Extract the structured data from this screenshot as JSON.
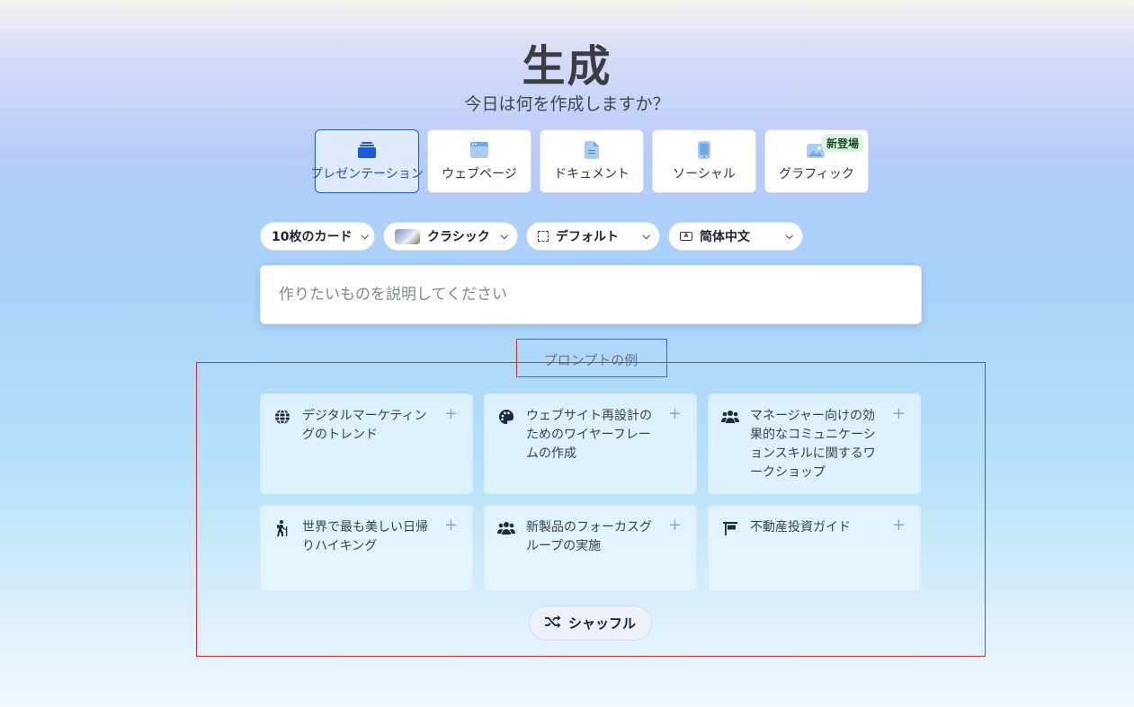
{
  "header": {
    "title": "生成",
    "subtitle": "今日は何を作成しますか？"
  },
  "content_types": [
    {
      "label": "プレゼンテーション",
      "icon": "presentation-icon",
      "active": true
    },
    {
      "label": "ウェブページ",
      "icon": "webpage-icon",
      "active": false
    },
    {
      "label": "ドキュメント",
      "icon": "document-icon",
      "active": false
    },
    {
      "label": "ソーシャル",
      "icon": "social-icon",
      "active": false
    },
    {
      "label": "グラフィック",
      "icon": "graphic-icon",
      "active": false,
      "badge": "新登場"
    }
  ],
  "options": {
    "card_count": "10枚のカード",
    "theme": "クラシック",
    "format": "デフォルト",
    "language": "简体中文"
  },
  "prompt": {
    "placeholder": "作りたいものを説明してください"
  },
  "examples": {
    "label": "プロンプトの例",
    "items": [
      {
        "text": "デジタルマーケティングのトレンド",
        "icon": "globe-icon"
      },
      {
        "text": "ウェブサイト再設計のためのワイヤーフレームの作成",
        "icon": "palette-icon"
      },
      {
        "text": "マネージャー向けの効果的なコミュニケーションスキルに関するワークショップ",
        "icon": "people-icon"
      },
      {
        "text": "世界で最も美しい日帰りハイキング",
        "icon": "hiker-icon"
      },
      {
        "text": "新製品のフォーカスグループの実施",
        "icon": "people-icon"
      },
      {
        "text": "不動産投資ガイド",
        "icon": "sign-icon"
      }
    ],
    "shuffle_label": "シャッフル"
  },
  "colors": {
    "accent": "#1d5bd6",
    "highlight_box": "#d92c2c"
  }
}
